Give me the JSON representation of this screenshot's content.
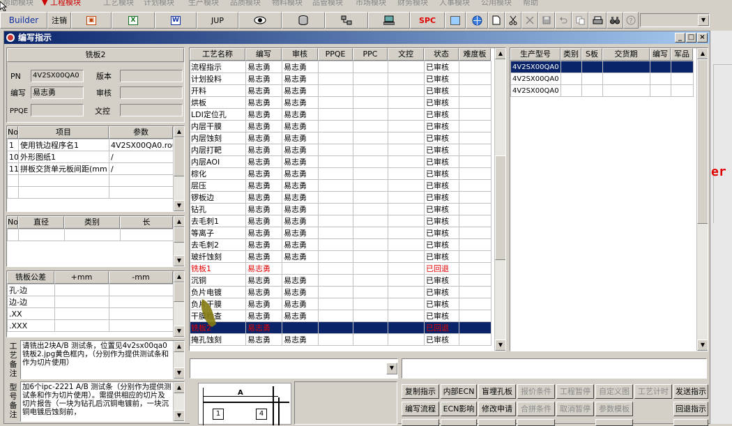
{
  "toolbar": {
    "builder_label": "Builder",
    "logout_label": "注销",
    "jup_label": "JUP",
    "spc_label": "SPC"
  },
  "window": {
    "title": "编写指示"
  },
  "left": {
    "process_name": "铣板2",
    "pn_label": "PN",
    "pn_value": "4V2SX00QA0",
    "version_label": "版本",
    "writer_label": "编写",
    "writer_value": "易志勇",
    "reviewer_label": "审核",
    "ppqe_label": "PPQE",
    "doc_control_label": "文控",
    "params_headers": [
      "No",
      "项目",
      "参数"
    ],
    "params_rows": [
      [
        "1",
        "使用铣边程序名1",
        "4V2SX00QA0.rou"
      ],
      [
        "10",
        "外形图纸1",
        "/"
      ],
      [
        "11",
        "拼板交货单元板间距(mm",
        "/"
      ]
    ],
    "tools_headers": [
      "No",
      "直径",
      "类别",
      "长"
    ],
    "tol_headers": [
      "铣板公差",
      "+mm",
      "-mm"
    ],
    "tol_rows": [
      "孔-边",
      "边-边",
      ".XX",
      ".XXX"
    ],
    "process_note_label": "工艺备注",
    "process_note": "请铣出2块A/B 测试条，位置见4v2sx00qa0铣板2.jpg黄色框内，（分别作为提供测试条和作为切片使用）",
    "model_note_label": "型号备注",
    "model_note": "加6个ipc-2221 A/B 测试条（分别作为提供测试条和作为切片使用）。需提供相应的切片及切片报告（一块为钻孔后沉铜电镀前，一块沉铜电镀后蚀刻前，"
  },
  "steps": {
    "headers": [
      "工艺名称",
      "编写",
      "审核",
      "PPQE",
      "PPC",
      "文控",
      "状态",
      "难度板"
    ],
    "rows": [
      [
        "流程指示",
        "易志勇",
        "易志勇",
        "已审核"
      ],
      [
        "计划投料",
        "易志勇",
        "易志勇",
        "已审核"
      ],
      [
        "开料",
        "易志勇",
        "易志勇",
        "已审核"
      ],
      [
        "烘板",
        "易志勇",
        "易志勇",
        "已审核"
      ],
      [
        "LDI定位孔",
        "易志勇",
        "易志勇",
        "已审核"
      ],
      [
        "内层干膜",
        "易志勇",
        "易志勇",
        "已审核"
      ],
      [
        "内层蚀刻",
        "易志勇",
        "易志勇",
        "已审核"
      ],
      [
        "内层打靶",
        "易志勇",
        "易志勇",
        "已审核"
      ],
      [
        "内层AOI",
        "易志勇",
        "易志勇",
        "已审核"
      ],
      [
        "棕化",
        "易志勇",
        "易志勇",
        "已审核"
      ],
      [
        "层压",
        "易志勇",
        "易志勇",
        "已审核"
      ],
      [
        "锣板边",
        "易志勇",
        "易志勇",
        "已审核"
      ],
      [
        "钻孔",
        "易志勇",
        "易志勇",
        "已审核"
      ],
      [
        "去毛刺1",
        "易志勇",
        "易志勇",
        "已审核"
      ],
      [
        "等离子",
        "易志勇",
        "易志勇",
        "已审核"
      ],
      [
        "去毛刺2",
        "易志勇",
        "易志勇",
        "已审核"
      ],
      [
        "玻纤蚀刻",
        "易志勇",
        "易志勇",
        "已审核"
      ],
      [
        "铣板1",
        "易志勇",
        "",
        "已回退"
      ],
      [
        "沉铜",
        "易志勇",
        "易志勇",
        "已审核"
      ],
      [
        "负片电镀",
        "易志勇",
        "易志勇",
        "已审核"
      ],
      [
        "负片干膜",
        "易志勇",
        "易志勇",
        "已审核"
      ],
      [
        "干膜检查",
        "易志勇",
        "易志勇",
        "已审核"
      ],
      [
        "铣板2",
        "易志勇",
        "",
        "已回退"
      ],
      [
        "掩孔蚀刻",
        "易志勇",
        "易志勇",
        "已审核"
      ]
    ]
  },
  "models": {
    "headers": [
      "生产型号",
      "类别",
      "S板",
      "交货期",
      "编写",
      "军品"
    ],
    "rows": [
      "4V2SX00QA0",
      "4V2SX00QA0",
      "4V2SX00QA0"
    ]
  },
  "preview": {
    "label_a": "A",
    "label_1": "1",
    "label_4": "4"
  },
  "buttons": {
    "row1": [
      "复制指示",
      "内部ECN",
      "盲埋孔板",
      "报价条件",
      "工程暂停",
      "自定义图",
      "工艺计时",
      "发送指示"
    ],
    "row2": [
      "编写流程",
      "ECN影响",
      "修改申请",
      "合拼条件",
      "取消暂停",
      "参数模板",
      "回退指示"
    ]
  },
  "bg_text": "er"
}
